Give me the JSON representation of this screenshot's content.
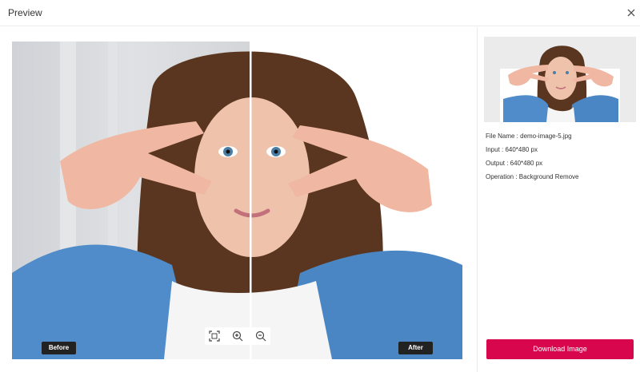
{
  "header": {
    "title": "Preview",
    "close_icon": "close-icon"
  },
  "compare": {
    "before_label": "Before",
    "after_label": "After",
    "slider_position": 0.53,
    "controls": [
      "fit-screen-icon",
      "zoom-in-icon",
      "zoom-out-icon"
    ]
  },
  "details": {
    "file_name": "File Name : demo-image-5.jpg",
    "input": "Input : 640*480 px",
    "output": "Output : 640*480 px",
    "operation": "Operation : Background Remove"
  },
  "actions": {
    "download_label": "Download Image"
  },
  "colors": {
    "accent": "#d8074d",
    "label_bg": "#222222",
    "denim": "#4f8cc9"
  }
}
